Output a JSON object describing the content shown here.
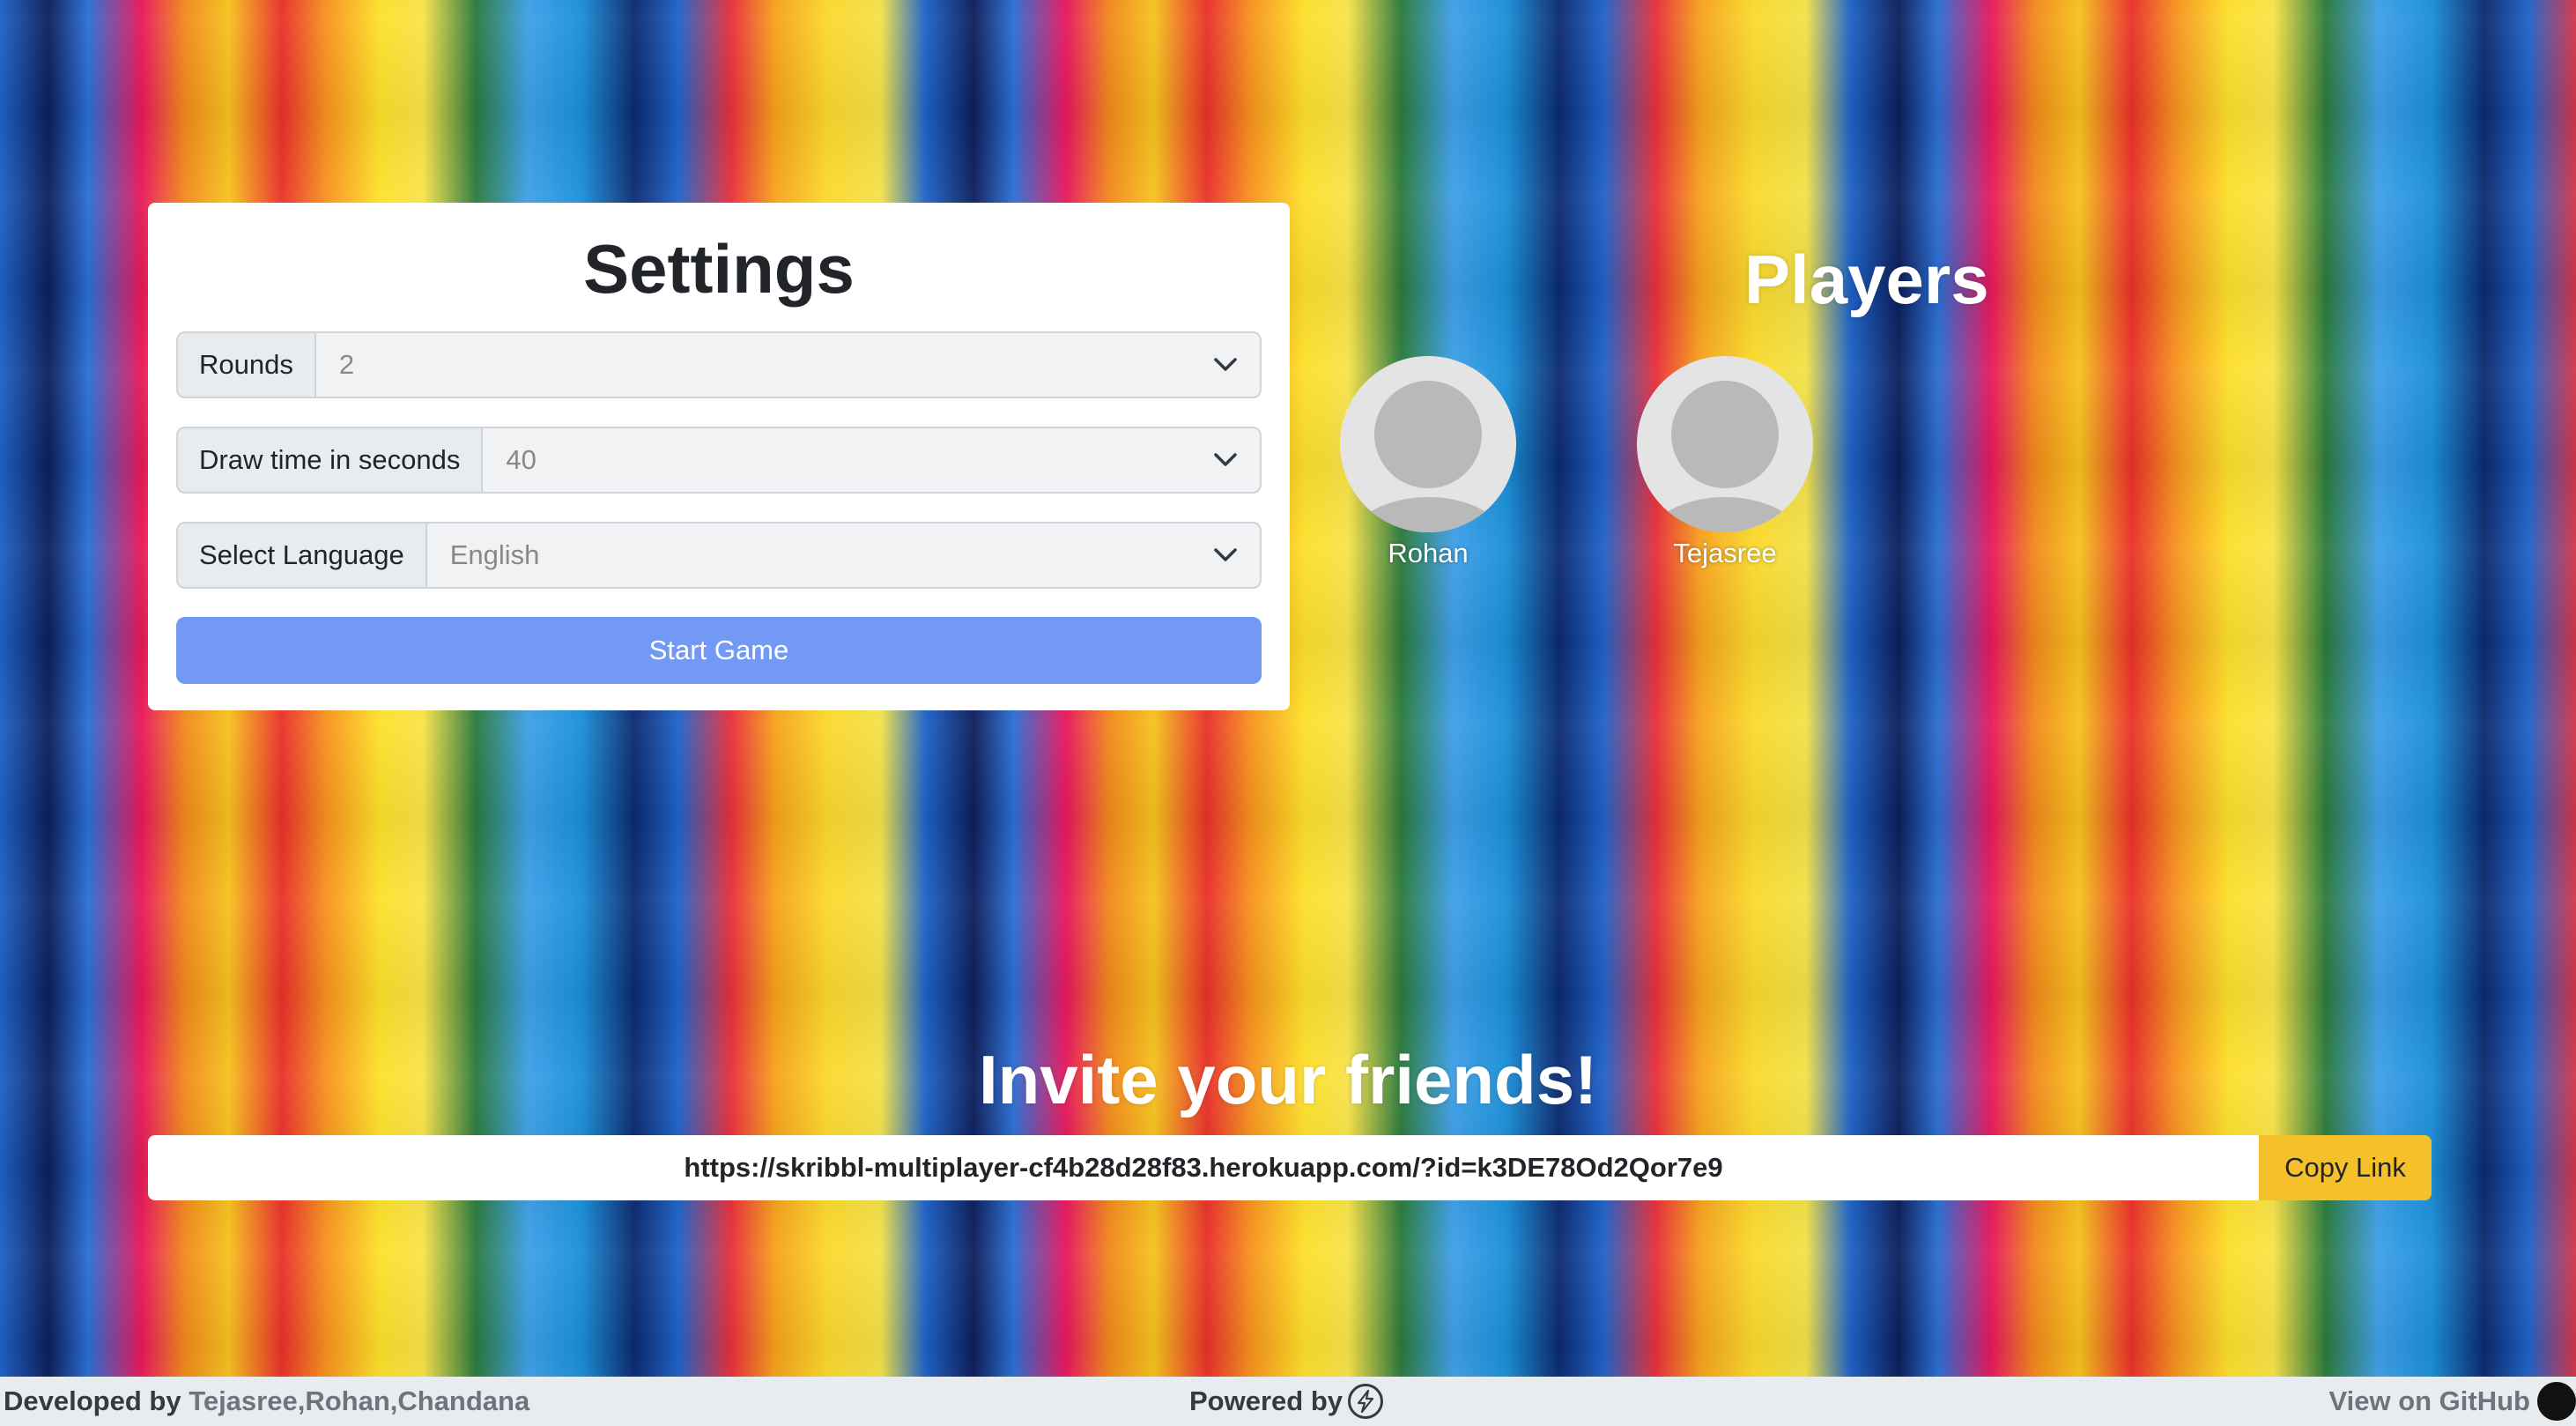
{
  "settings": {
    "title": "Settings",
    "rounds_label": "Rounds",
    "rounds_value": "2",
    "drawtime_label": "Draw time in seconds",
    "drawtime_value": "40",
    "language_label": "Select Language",
    "language_value": "English",
    "start_button": "Start Game"
  },
  "players": {
    "title": "Players",
    "list": [
      {
        "name": "Rohan",
        "avatar_icon": "user-avatar-icon"
      },
      {
        "name": "Tejasree",
        "avatar_icon": "user-avatar-icon"
      }
    ]
  },
  "invite": {
    "title": "Invite your friends!",
    "link": "https://skribbl-multiplayer-cf4b28d28f83.herokuapp.com/?id=k3DE78Od2Qor7e9",
    "copy_button": "Copy Link"
  },
  "footer": {
    "developed_by": "Developed by ",
    "developers": "Tejasree,Rohan,Chandana",
    "powered_by": "Powered by",
    "powered_icon": "lightning-bolt-icon",
    "github_label": "View on GitHub",
    "github_icon": "github-icon"
  },
  "colors": {
    "start_button": "#7299f4",
    "copy_button": "#f5c02a",
    "footer_bg": "#e9ecef"
  }
}
